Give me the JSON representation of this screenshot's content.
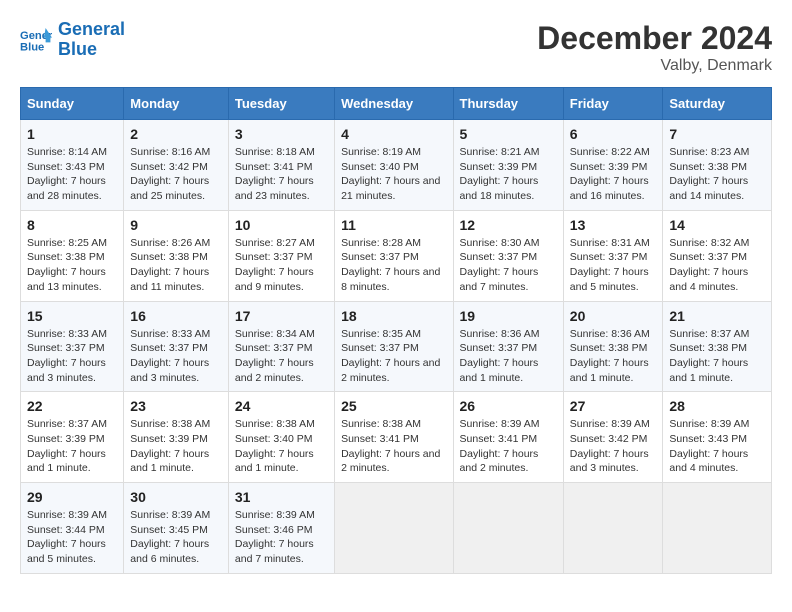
{
  "header": {
    "logo_line1": "General",
    "logo_line2": "Blue",
    "month_title": "December 2024",
    "location": "Valby, Denmark"
  },
  "columns": [
    "Sunday",
    "Monday",
    "Tuesday",
    "Wednesday",
    "Thursday",
    "Friday",
    "Saturday"
  ],
  "weeks": [
    [
      {
        "day": "1",
        "sunrise": "8:14 AM",
        "sunset": "3:43 PM",
        "daylight": "7 hours and 28 minutes."
      },
      {
        "day": "2",
        "sunrise": "8:16 AM",
        "sunset": "3:42 PM",
        "daylight": "7 hours and 25 minutes."
      },
      {
        "day": "3",
        "sunrise": "8:18 AM",
        "sunset": "3:41 PM",
        "daylight": "7 hours and 23 minutes."
      },
      {
        "day": "4",
        "sunrise": "8:19 AM",
        "sunset": "3:40 PM",
        "daylight": "7 hours and 21 minutes."
      },
      {
        "day": "5",
        "sunrise": "8:21 AM",
        "sunset": "3:39 PM",
        "daylight": "7 hours and 18 minutes."
      },
      {
        "day": "6",
        "sunrise": "8:22 AM",
        "sunset": "3:39 PM",
        "daylight": "7 hours and 16 minutes."
      },
      {
        "day": "7",
        "sunrise": "8:23 AM",
        "sunset": "3:38 PM",
        "daylight": "7 hours and 14 minutes."
      }
    ],
    [
      {
        "day": "8",
        "sunrise": "8:25 AM",
        "sunset": "3:38 PM",
        "daylight": "7 hours and 13 minutes."
      },
      {
        "day": "9",
        "sunrise": "8:26 AM",
        "sunset": "3:38 PM",
        "daylight": "7 hours and 11 minutes."
      },
      {
        "day": "10",
        "sunrise": "8:27 AM",
        "sunset": "3:37 PM",
        "daylight": "7 hours and 9 minutes."
      },
      {
        "day": "11",
        "sunrise": "8:28 AM",
        "sunset": "3:37 PM",
        "daylight": "7 hours and 8 minutes."
      },
      {
        "day": "12",
        "sunrise": "8:30 AM",
        "sunset": "3:37 PM",
        "daylight": "7 hours and 7 minutes."
      },
      {
        "day": "13",
        "sunrise": "8:31 AM",
        "sunset": "3:37 PM",
        "daylight": "7 hours and 5 minutes."
      },
      {
        "day": "14",
        "sunrise": "8:32 AM",
        "sunset": "3:37 PM",
        "daylight": "7 hours and 4 minutes."
      }
    ],
    [
      {
        "day": "15",
        "sunrise": "8:33 AM",
        "sunset": "3:37 PM",
        "daylight": "7 hours and 3 minutes."
      },
      {
        "day": "16",
        "sunrise": "8:33 AM",
        "sunset": "3:37 PM",
        "daylight": "7 hours and 3 minutes."
      },
      {
        "day": "17",
        "sunrise": "8:34 AM",
        "sunset": "3:37 PM",
        "daylight": "7 hours and 2 minutes."
      },
      {
        "day": "18",
        "sunrise": "8:35 AM",
        "sunset": "3:37 PM",
        "daylight": "7 hours and 2 minutes."
      },
      {
        "day": "19",
        "sunrise": "8:36 AM",
        "sunset": "3:37 PM",
        "daylight": "7 hours and 1 minute."
      },
      {
        "day": "20",
        "sunrise": "8:36 AM",
        "sunset": "3:38 PM",
        "daylight": "7 hours and 1 minute."
      },
      {
        "day": "21",
        "sunrise": "8:37 AM",
        "sunset": "3:38 PM",
        "daylight": "7 hours and 1 minute."
      }
    ],
    [
      {
        "day": "22",
        "sunrise": "8:37 AM",
        "sunset": "3:39 PM",
        "daylight": "7 hours and 1 minute."
      },
      {
        "day": "23",
        "sunrise": "8:38 AM",
        "sunset": "3:39 PM",
        "daylight": "7 hours and 1 minute."
      },
      {
        "day": "24",
        "sunrise": "8:38 AM",
        "sunset": "3:40 PM",
        "daylight": "7 hours and 1 minute."
      },
      {
        "day": "25",
        "sunrise": "8:38 AM",
        "sunset": "3:41 PM",
        "daylight": "7 hours and 2 minutes."
      },
      {
        "day": "26",
        "sunrise": "8:39 AM",
        "sunset": "3:41 PM",
        "daylight": "7 hours and 2 minutes."
      },
      {
        "day": "27",
        "sunrise": "8:39 AM",
        "sunset": "3:42 PM",
        "daylight": "7 hours and 3 minutes."
      },
      {
        "day": "28",
        "sunrise": "8:39 AM",
        "sunset": "3:43 PM",
        "daylight": "7 hours and 4 minutes."
      }
    ],
    [
      {
        "day": "29",
        "sunrise": "8:39 AM",
        "sunset": "3:44 PM",
        "daylight": "7 hours and 5 minutes."
      },
      {
        "day": "30",
        "sunrise": "8:39 AM",
        "sunset": "3:45 PM",
        "daylight": "7 hours and 6 minutes."
      },
      {
        "day": "31",
        "sunrise": "8:39 AM",
        "sunset": "3:46 PM",
        "daylight": "7 hours and 7 minutes."
      },
      null,
      null,
      null,
      null
    ]
  ]
}
